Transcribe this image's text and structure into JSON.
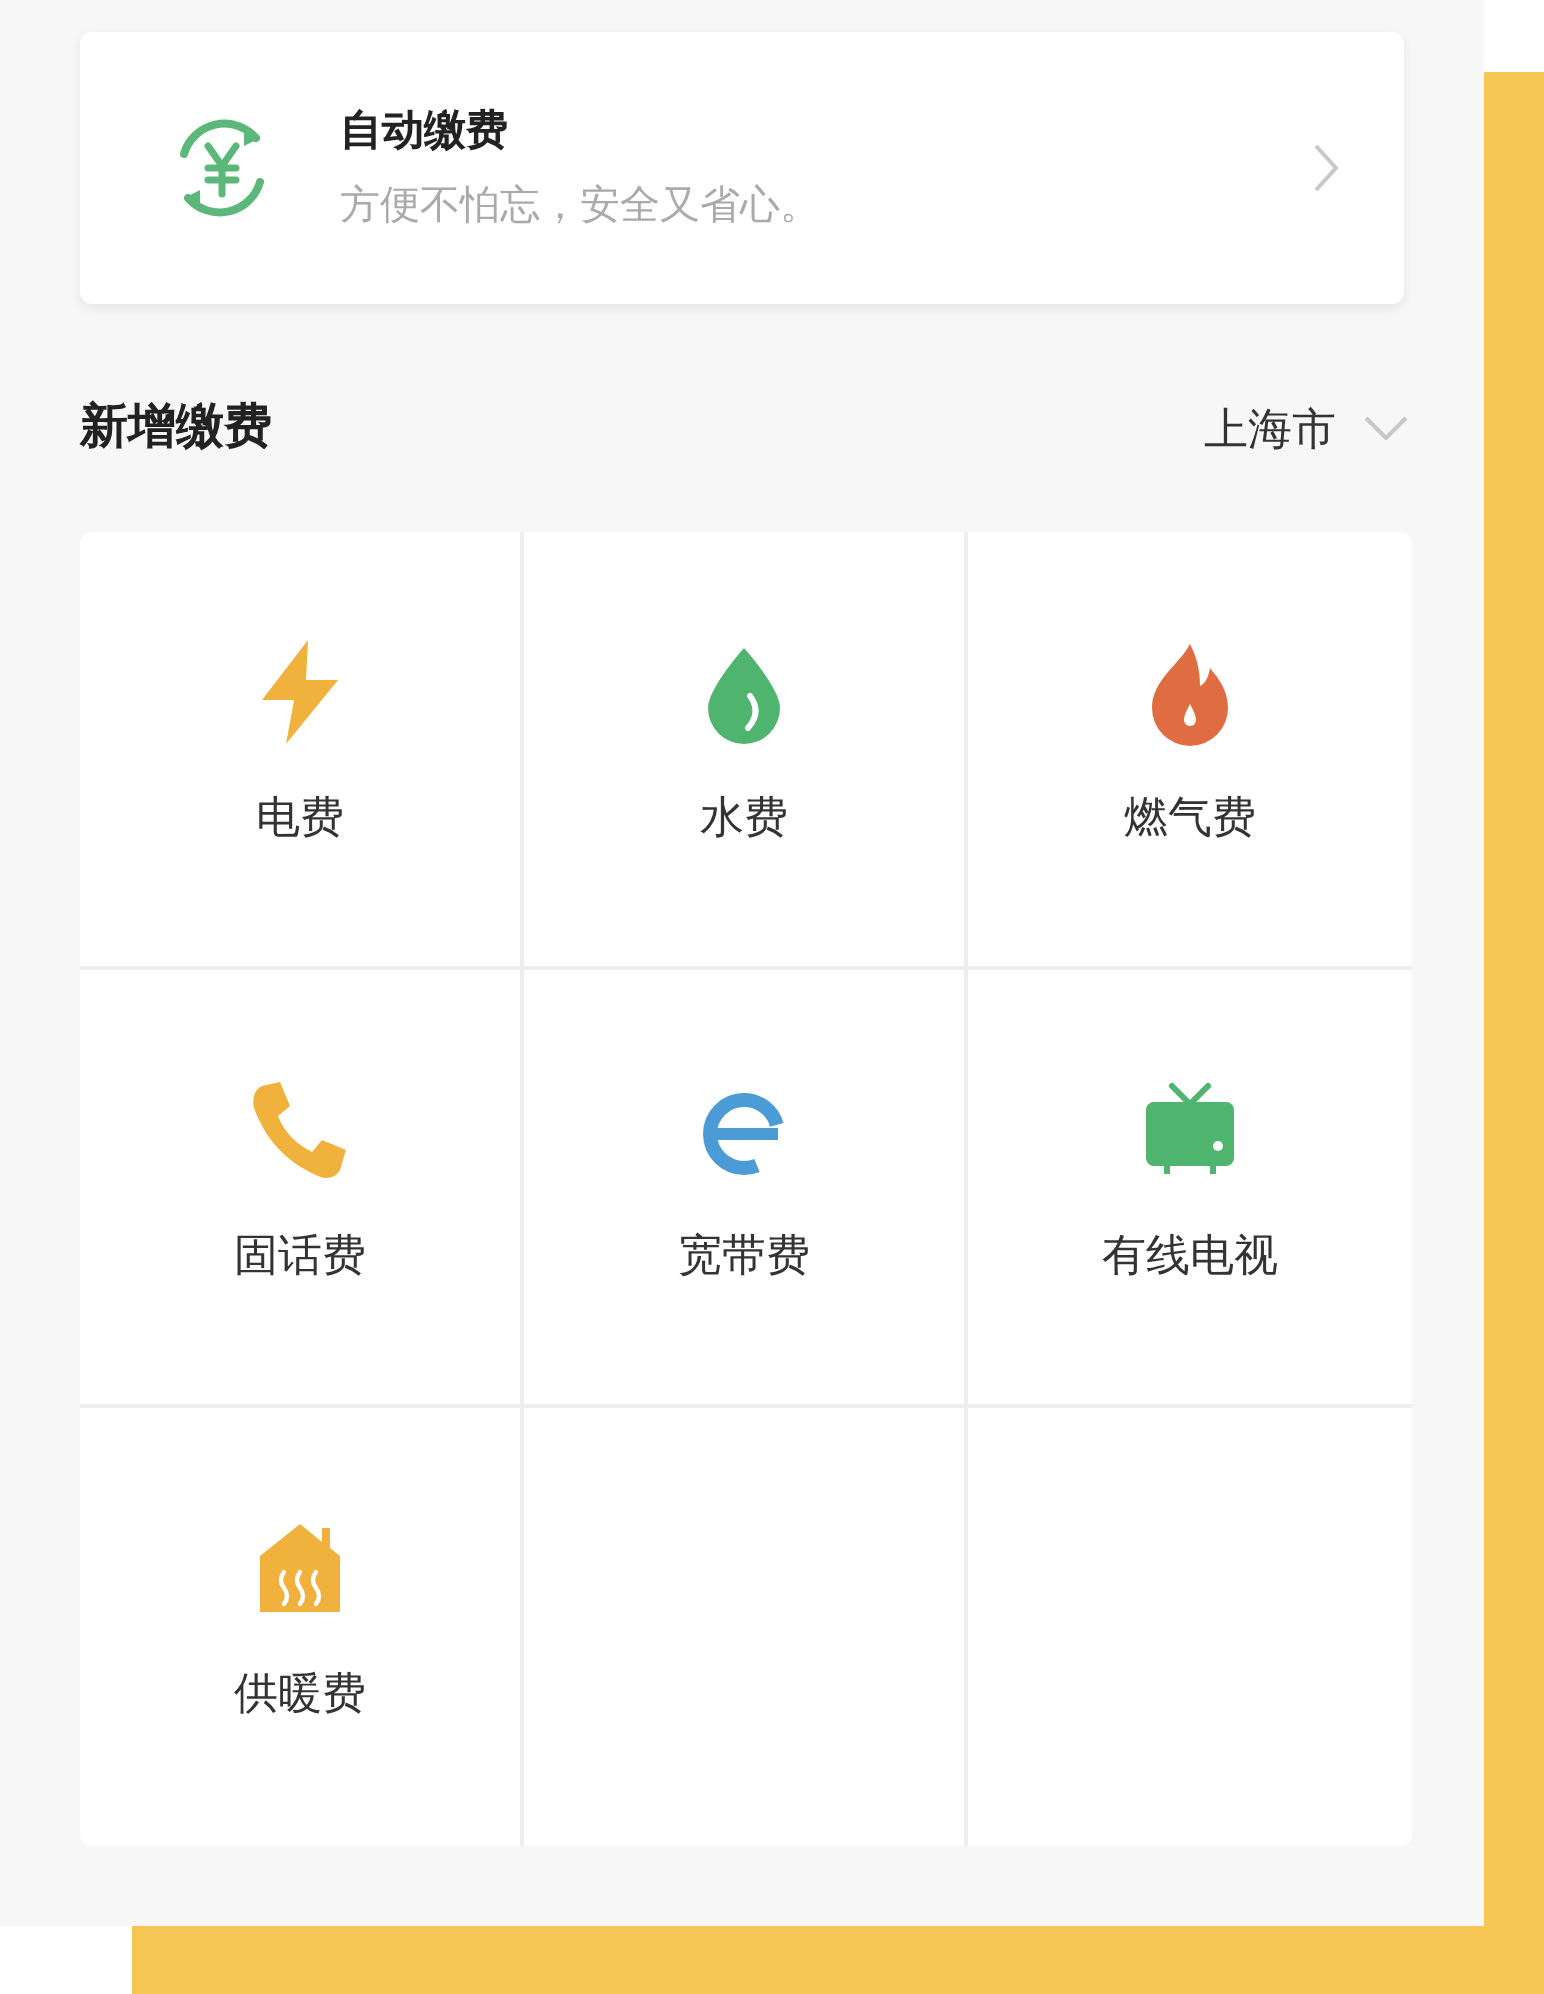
{
  "autopay": {
    "title": "自动缴费",
    "subtitle": "方便不怕忘，安全又省心。"
  },
  "section": {
    "title": "新增缴费",
    "city": "上海市"
  },
  "services": [
    {
      "label": "电费",
      "kind": "electric"
    },
    {
      "label": "水费",
      "kind": "water"
    },
    {
      "label": "燃气费",
      "kind": "gas"
    },
    {
      "label": "固话费",
      "kind": "phone"
    },
    {
      "label": "宽带费",
      "kind": "broadband"
    },
    {
      "label": "有线电视",
      "kind": "tv"
    },
    {
      "label": "供暖费",
      "kind": "heating"
    }
  ]
}
